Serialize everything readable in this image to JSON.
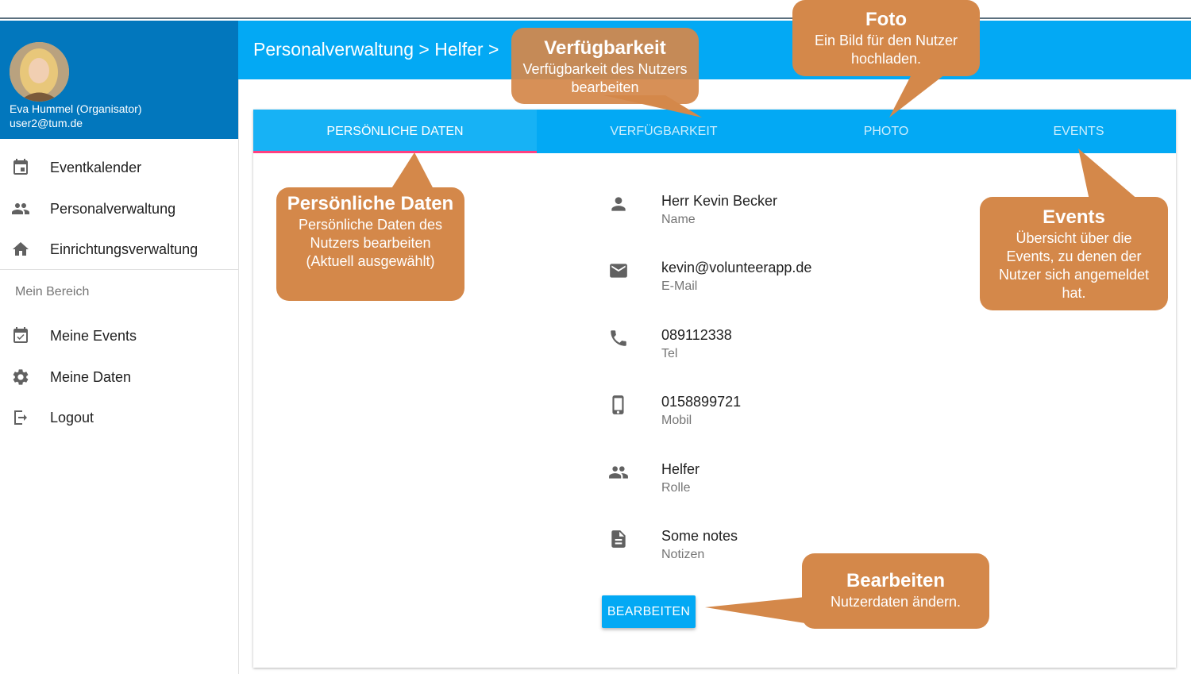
{
  "user": {
    "name": "Eva Hummel (Organisator)",
    "email": "user2@tum.de"
  },
  "nav": {
    "items": [
      {
        "label": "Eventkalender",
        "icon": "calendar-icon"
      },
      {
        "label": "Personalverwaltung",
        "icon": "people-icon"
      },
      {
        "label": "Einrichtungsverwaltung",
        "icon": "home-icon"
      }
    ],
    "section_label": "Mein Bereich",
    "my_items": [
      {
        "label": "Meine Events",
        "icon": "calendar-check-icon"
      },
      {
        "label": "Meine Daten",
        "icon": "gear-icon"
      },
      {
        "label": "Logout",
        "icon": "logout-icon"
      }
    ]
  },
  "header": {
    "breadcrumb": "Personalverwaltung > Helfer >"
  },
  "tabs": [
    {
      "label": "PERSÖNLICHE DATEN",
      "active": true
    },
    {
      "label": "VERFÜGBARKEIT",
      "active": false
    },
    {
      "label": "PHOTO",
      "active": false
    },
    {
      "label": "EVENTS",
      "active": false
    }
  ],
  "fields": [
    {
      "value": "Herr Kevin Becker",
      "label": "Name",
      "icon": "person-icon"
    },
    {
      "value": "kevin@volunteerapp.de",
      "label": "E-Mail",
      "icon": "mail-icon"
    },
    {
      "value": "089112338",
      "label": "Tel",
      "icon": "phone-icon"
    },
    {
      "value": "0158899721",
      "label": "Mobil",
      "icon": "mobile-icon"
    },
    {
      "value": "Helfer",
      "label": "Rolle",
      "icon": "people-icon"
    },
    {
      "value": "Some notes",
      "label": "Notizen",
      "icon": "document-icon"
    }
  ],
  "edit_button": "BEARBEITEN",
  "callouts": {
    "verfuegbarkeit": {
      "title": "Verfügbarkeit",
      "body": "Verfügbarkeit des Nutzers bearbeiten"
    },
    "foto": {
      "title": "Foto",
      "body": "Ein Bild für den Nutzer hochladen."
    },
    "persoenlich": {
      "title": "Persönliche Daten",
      "body": "Persönliche Daten des Nutzers bearbeiten (Aktuell ausgewählt)"
    },
    "events": {
      "title": "Events",
      "body": "Übersicht über die Events, zu denen der Nutzer sich angemeldet hat."
    },
    "bearbeiten": {
      "title": "Bearbeiten",
      "body": "Nutzerdaten ändern."
    }
  },
  "colors": {
    "primary": "#03a9f4",
    "profile_bg": "#0277bd",
    "accent": "#ff4081",
    "callout": "#d4884a"
  }
}
